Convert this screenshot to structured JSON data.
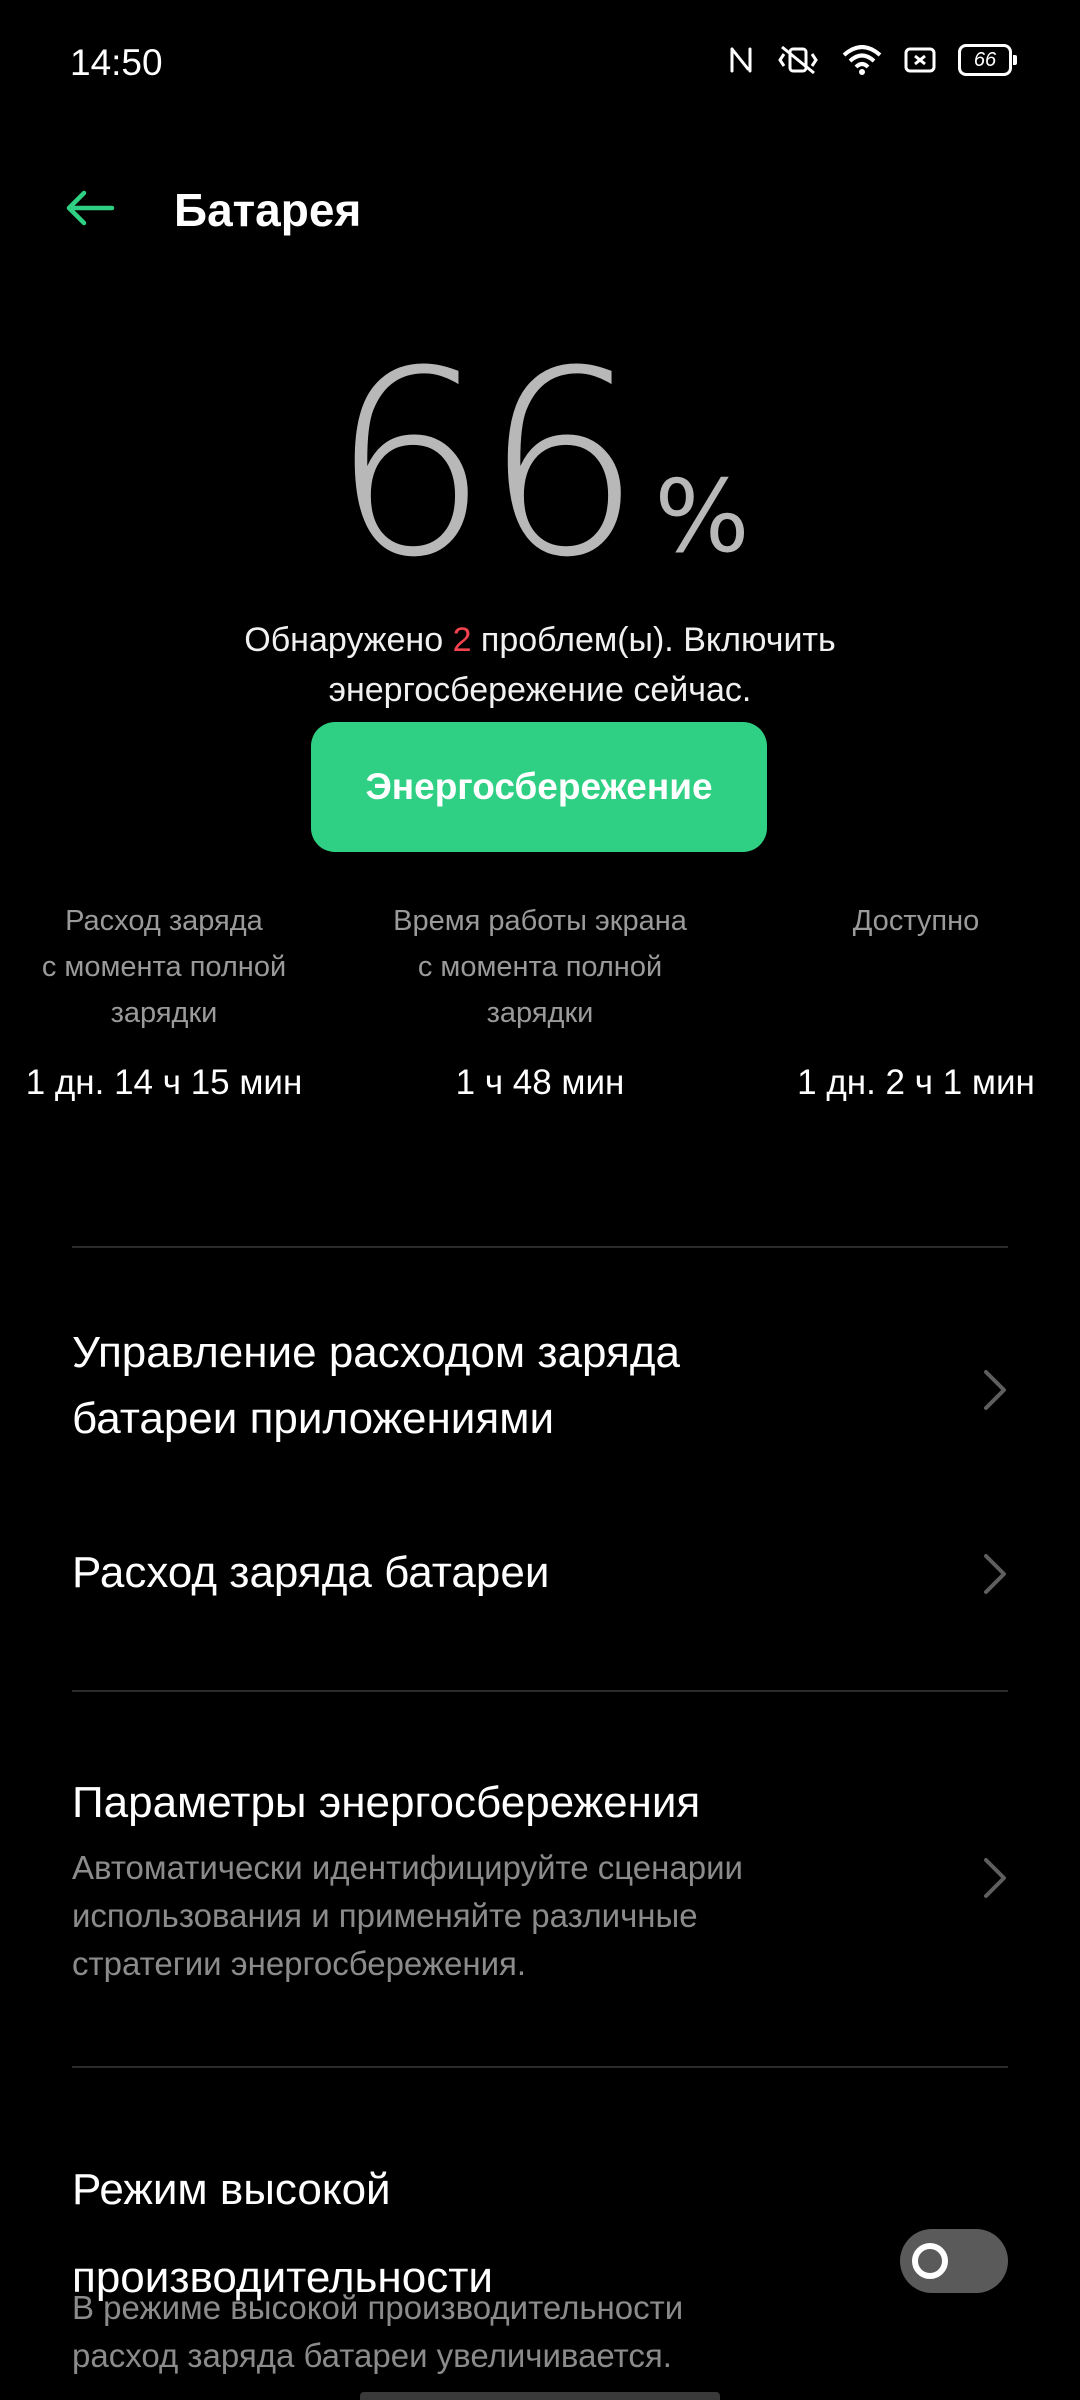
{
  "status_bar": {
    "time": "14:50",
    "battery_level": "66",
    "icons": [
      "nfc-icon",
      "vibrate-icon",
      "wifi-icon",
      "sim-icon",
      "battery-icon"
    ]
  },
  "header": {
    "title": "Батарея",
    "back_icon": "back-arrow-icon"
  },
  "battery": {
    "percent": "66",
    "percent_sign": "%"
  },
  "issues": {
    "prefix": "Обнаружено ",
    "count": "2",
    "suffix_line1": " проблем(ы). Включить",
    "line2": "энергосбережение сейчас."
  },
  "saver_button": {
    "label": "Энергосбережение"
  },
  "stats": [
    {
      "label_lines": [
        "Расход заряда",
        "с момента полной",
        "зарядки"
      ],
      "value": "1 дн. 14 ч 15 мин"
    },
    {
      "label_lines": [
        "Время работы экрана",
        "с момента полной",
        "зарядки"
      ],
      "value": "1 ч 48 мин"
    },
    {
      "label_lines": [
        "Доступно",
        "",
        ""
      ],
      "value": "1 дн. 2 ч 1 мин"
    }
  ],
  "menu": {
    "app_usage": {
      "title_line1": "Управление расходом заряда",
      "title_line2": "батареи приложениями"
    },
    "battery_usage": {
      "title": "Расход заряда батареи"
    },
    "power_saving_settings": {
      "title": "Параметры энергосбережения",
      "sub_line1": "Автоматически идентифицируйте сценарии",
      "sub_line2": "использования и применяйте различные",
      "sub_line3": "стратегии энергосбережения."
    },
    "high_performance": {
      "title_line1": "Режим высокой",
      "title_line2": "производительности",
      "sub_line1": "В режиме высокой производительности",
      "sub_line2": "расход заряда батареи увеличивается.",
      "enabled": false
    }
  },
  "colors": {
    "accent": "#2fd083",
    "warning": "#f4434f",
    "background": "#000000"
  }
}
